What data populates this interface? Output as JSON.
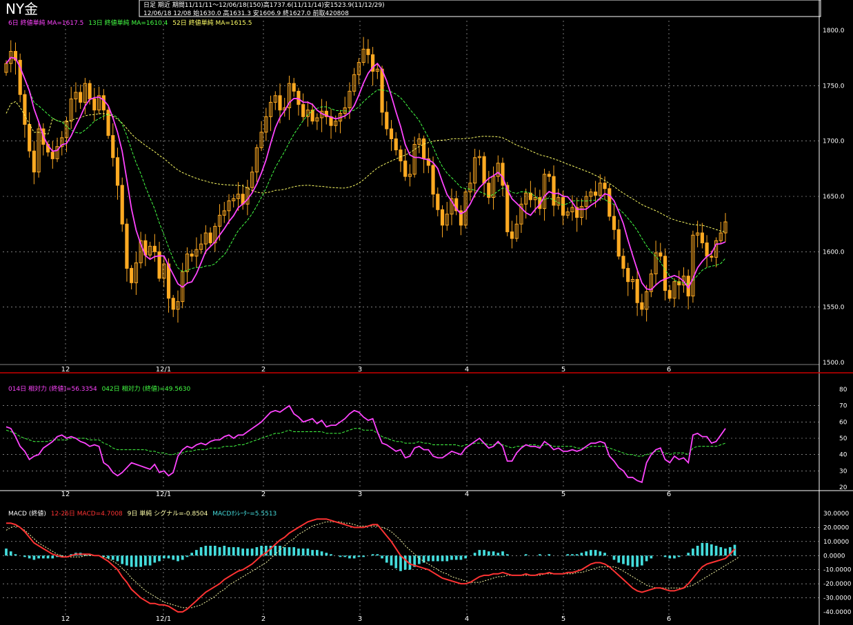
{
  "header": {
    "title": "NY金",
    "info_line1": "日足 期近  期間11/11/11～12/06/18(150)高1737.6(11/11/14)安1523.9(11/12/29)",
    "info_line2": "12/06/18 12/08 始1630.0 高1631.3 安1606.9 終1627.0 前取420808"
  },
  "legends": {
    "price": [
      {
        "text": "6日 終値単純 MA=1617.5",
        "color": "#ff44ff"
      },
      {
        "text": "13日 終値単純 MA=1610.4",
        "color": "#44ff44"
      },
      {
        "text": "52日 終値単純 MA=1615.5",
        "color": "#ffff66"
      }
    ],
    "rsi": [
      {
        "text": "014日 相対力 (終値)=56.3354",
        "color": "#ff44ff"
      },
      {
        "text": "042日 相対力 (終値)=49.5630",
        "color": "#44ff44"
      }
    ],
    "macd": [
      {
        "text": "MACD (終値)",
        "color": "#ffffff"
      },
      {
        "text": "12-26日 MACD=4.7008",
        "color": "#ff3333"
      },
      {
        "text": "9日 単純 シグナル=-0.8504",
        "color": "#ffffaa"
      },
      {
        "text": "MACDｵｼﾚｰﾀｰ=5.5513",
        "color": "#44dddd"
      }
    ]
  },
  "chart_data": [
    {
      "type": "candlestick",
      "title": "NY金",
      "x_labels": [
        "12",
        "12/1",
        "2",
        "3",
        "4",
        "5",
        "6"
      ],
      "ylim": [
        1500,
        1800
      ],
      "yticks": [
        "1800.0",
        "1750.0",
        "1700.0",
        "1650.0",
        "1600.0",
        "1550.0",
        "1500.0"
      ],
      "grid": true,
      "close": [
        1770,
        1781,
        1773,
        1742,
        1715,
        1691,
        1672,
        1711,
        1697,
        1690,
        1684,
        1695,
        1703,
        1718,
        1738,
        1744,
        1735,
        1752,
        1738,
        1728,
        1741,
        1728,
        1705,
        1685,
        1660,
        1625,
        1585,
        1572,
        1590,
        1610,
        1597,
        1605,
        1600,
        1576,
        1589,
        1558,
        1548,
        1555,
        1582,
        1598,
        1596,
        1602,
        1607,
        1617,
        1608,
        1623,
        1633,
        1637,
        1646,
        1648,
        1652,
        1643,
        1658,
        1672,
        1694,
        1708,
        1722,
        1735,
        1741,
        1728,
        1730,
        1752,
        1745,
        1733,
        1722,
        1728,
        1718,
        1721,
        1727,
        1722,
        1714,
        1718,
        1725,
        1730,
        1745,
        1760,
        1771,
        1783,
        1778,
        1763,
        1765,
        1726,
        1711,
        1702,
        1692,
        1682,
        1668,
        1670,
        1697,
        1702,
        1684,
        1678,
        1652,
        1638,
        1624,
        1634,
        1648,
        1637,
        1624,
        1654,
        1662,
        1685,
        1686,
        1662,
        1649,
        1668,
        1680,
        1660,
        1618,
        1612,
        1625,
        1643,
        1653,
        1647,
        1649,
        1639,
        1670,
        1668,
        1642,
        1649,
        1633,
        1636,
        1640,
        1631,
        1641,
        1650,
        1654,
        1651,
        1662,
        1657,
        1632,
        1620,
        1596,
        1585,
        1573,
        1575,
        1554,
        1548,
        1564,
        1580,
        1599,
        1596,
        1565,
        1558,
        1573,
        1570,
        1578,
        1560,
        1615,
        1617,
        1608,
        1596,
        1595,
        1610,
        1617,
        1627
      ]
    },
    {
      "type": "line",
      "title": "相対力 (終値)",
      "ylim": [
        20,
        80
      ],
      "yticks": [
        "80",
        "70",
        "60",
        "50",
        "40",
        "30",
        "20"
      ],
      "series": [
        {
          "name": "014日 相対力 (終値)",
          "values": [
            57,
            56,
            51,
            45,
            42,
            37,
            39,
            40,
            44,
            46,
            48,
            51,
            52,
            50,
            51,
            50,
            48,
            47,
            45,
            46,
            45,
            35,
            33,
            29,
            27,
            29,
            32,
            35,
            34,
            33,
            32,
            31,
            34,
            29,
            30,
            27,
            29,
            39,
            43,
            45,
            44,
            46,
            47,
            46,
            48,
            49,
            49,
            51,
            52,
            50,
            52,
            52,
            54,
            56,
            58,
            60,
            63,
            66,
            67,
            66,
            68,
            70,
            65,
            63,
            60,
            61,
            62,
            59,
            61,
            57,
            58,
            58,
            60,
            62,
            65,
            67,
            66,
            63,
            61,
            62,
            54,
            47,
            46,
            44,
            42,
            43,
            38,
            39,
            44,
            45,
            43,
            43,
            39,
            38,
            38,
            40,
            42,
            41,
            40,
            44,
            46,
            48,
            50,
            47,
            44,
            45,
            48,
            45,
            36,
            36,
            41,
            44,
            46,
            45,
            45,
            44,
            48,
            46,
            43,
            44,
            42,
            42,
            43,
            42,
            43,
            45,
            47,
            47,
            48,
            47,
            39,
            36,
            32,
            30,
            26,
            26,
            24,
            23,
            35,
            40,
            43,
            44,
            37,
            35,
            39,
            37,
            38,
            35,
            52,
            53,
            51,
            51,
            47,
            48,
            52,
            56
          ]
        },
        {
          "name": "042日 相対力 (終値)",
          "values": [
            55,
            54,
            53,
            51,
            50,
            49,
            48,
            48,
            48,
            48,
            49,
            49,
            49,
            49,
            50,
            50,
            50,
            50,
            49,
            49,
            49,
            47,
            46,
            44,
            43,
            43,
            43,
            43,
            43,
            43,
            43,
            42,
            42,
            41,
            41,
            40,
            40,
            41,
            41,
            42,
            42,
            43,
            43,
            43,
            44,
            44,
            44,
            45,
            45,
            45,
            46,
            46,
            47,
            48,
            49,
            50,
            51,
            52,
            53,
            53,
            54,
            55,
            54,
            54,
            54,
            54,
            54,
            54,
            54,
            53,
            53,
            53,
            53,
            54,
            55,
            56,
            56,
            55,
            55,
            55,
            53,
            51,
            50,
            49,
            48,
            48,
            47,
            47,
            47,
            48,
            47,
            47,
            46,
            46,
            46,
            46,
            46,
            46,
            45,
            46,
            46,
            47,
            47,
            47,
            46,
            46,
            47,
            46,
            45,
            44,
            45,
            45,
            46,
            46,
            46,
            45,
            46,
            46,
            45,
            45,
            45,
            45,
            45,
            44,
            44,
            44,
            45,
            45,
            45,
            45,
            44,
            43,
            42,
            41,
            40,
            40,
            39,
            39,
            40,
            41,
            42,
            42,
            41,
            40,
            41,
            41,
            41,
            40,
            44,
            45,
            45,
            45,
            45,
            45,
            46,
            47
          ]
        }
      ]
    },
    {
      "type": "line",
      "title": "MACD (終値)",
      "ylim": [
        -40,
        30
      ],
      "yticks": [
        "30.0000",
        "20.0000",
        "10.0000",
        "0.0000",
        "-10.0000",
        "-20.0000",
        "-30.0000",
        "-40.0000"
      ],
      "series": [
        {
          "name": "12-26日 MACD",
          "values": [
            23,
            23,
            22,
            20,
            17,
            13,
            9,
            7,
            5,
            3,
            1,
            0,
            -1,
            -1,
            0,
            1,
            1,
            1,
            1,
            0,
            0,
            -2,
            -4,
            -7,
            -10,
            -15,
            -19,
            -24,
            -27,
            -30,
            -32,
            -34,
            -34,
            -35,
            -35,
            -36,
            -38,
            -40,
            -40,
            -38,
            -35,
            -32,
            -29,
            -26,
            -24,
            -22,
            -20,
            -17,
            -15,
            -13,
            -11,
            -10,
            -8,
            -6,
            -3,
            0,
            2,
            5,
            8,
            11,
            13,
            16,
            18,
            20,
            22,
            24,
            25,
            26,
            26,
            26,
            25,
            24,
            23,
            22,
            21,
            20,
            20,
            20,
            21,
            22,
            22,
            18,
            14,
            10,
            5,
            0,
            -3,
            -6,
            -7,
            -8,
            -9,
            -10,
            -12,
            -14,
            -16,
            -17,
            -18,
            -19,
            -20,
            -20,
            -19,
            -17,
            -15,
            -14,
            -14,
            -13,
            -13,
            -12,
            -13,
            -14,
            -14,
            -14,
            -13,
            -14,
            -14,
            -13,
            -13,
            -12,
            -13,
            -13,
            -13,
            -12,
            -12,
            -11,
            -10,
            -8,
            -6,
            -5,
            -5,
            -6,
            -8,
            -11,
            -14,
            -17,
            -20,
            -23,
            -25,
            -26,
            -25,
            -24,
            -23,
            -23,
            -24,
            -25,
            -25,
            -24,
            -23,
            -20,
            -16,
            -12,
            -8,
            -6,
            -5,
            -4,
            -3,
            -2,
            1,
            4.7
          ]
        },
        {
          "name": "9日 単純 シグナル",
          "values": [
            18,
            20,
            21,
            20,
            18,
            15,
            12,
            9,
            7,
            5,
            3,
            1,
            0,
            -1,
            -1,
            -1,
            -1,
            0,
            0,
            0,
            0,
            -1,
            -2,
            -4,
            -6,
            -9,
            -12,
            -16,
            -19,
            -22,
            -25,
            -27,
            -29,
            -31,
            -33,
            -34,
            -35,
            -36,
            -37,
            -37,
            -37,
            -36,
            -35,
            -33,
            -31,
            -29,
            -26,
            -24,
            -21,
            -19,
            -17,
            -15,
            -13,
            -11,
            -9,
            -7,
            -5,
            -2,
            1,
            4,
            7,
            10,
            12,
            15,
            17,
            19,
            21,
            22,
            23,
            24,
            24,
            24,
            24,
            23,
            23,
            22,
            21,
            21,
            21,
            21,
            21,
            20,
            19,
            17,
            14,
            11,
            7,
            4,
            1,
            -2,
            -4,
            -6,
            -8,
            -10,
            -12,
            -13,
            -15,
            -16,
            -17,
            -18,
            -19,
            -19,
            -19,
            -18,
            -17,
            -16,
            -15,
            -15,
            -14,
            -14,
            -14,
            -14,
            -14,
            -14,
            -14,
            -14,
            -13,
            -13,
            -13,
            -13,
            -13,
            -13,
            -13,
            -12,
            -12,
            -11,
            -10,
            -9,
            -8,
            -8,
            -8,
            -8,
            -9,
            -11,
            -13,
            -15,
            -17,
            -19,
            -21,
            -22,
            -23,
            -23,
            -23,
            -23,
            -23,
            -23,
            -23,
            -22,
            -21,
            -19,
            -17,
            -15,
            -13,
            -11,
            -9,
            -7,
            -5,
            -3,
            -0.85
          ]
        }
      ],
      "histogram_name": "MACDｵｼﾚｰﾀｰ"
    }
  ],
  "colors": {
    "up_candle": "#ffaa22",
    "ma6": "#ff44ff",
    "ma13": "#44ff44",
    "ma52": "#ffff66",
    "rsi14": "#ff44ff",
    "rsi42": "#44ff44",
    "macd": "#ff3333",
    "signal": "#ffffaa",
    "histogram": "#44dddd",
    "grid": "#cccccc",
    "border": "#cc0000"
  }
}
